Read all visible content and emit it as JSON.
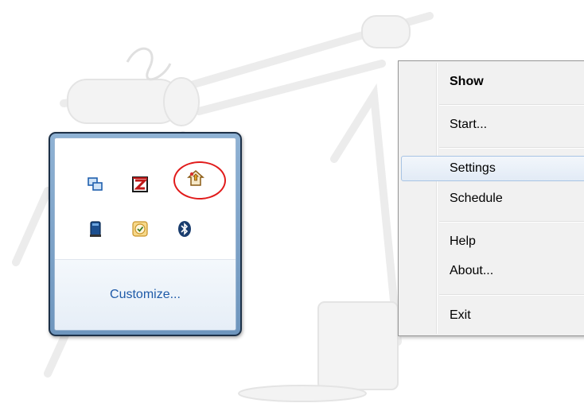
{
  "tray_flyout": {
    "icons": [
      {
        "name": "network-monitor-icon"
      },
      {
        "name": "filezilla-icon"
      },
      {
        "name": "backup-app-icon"
      },
      {
        "name": "server-icon"
      },
      {
        "name": "outlook-reminder-icon"
      },
      {
        "name": "bluetooth-icon"
      }
    ],
    "customize_label": "Customize..."
  },
  "context_menu": {
    "items": [
      {
        "label": "Show",
        "bold": true
      },
      {
        "label": "Start..."
      },
      {
        "label": "Settings",
        "hovered": true
      },
      {
        "label": "Schedule"
      },
      {
        "label": "Help"
      },
      {
        "label": "About..."
      },
      {
        "label": "Exit"
      }
    ]
  },
  "colors": {
    "highlight_ring": "#e11b1b",
    "link": "#1e5aa8",
    "flyout_border": "#1d3148",
    "menu_hover_border": "#a8c4e4"
  }
}
